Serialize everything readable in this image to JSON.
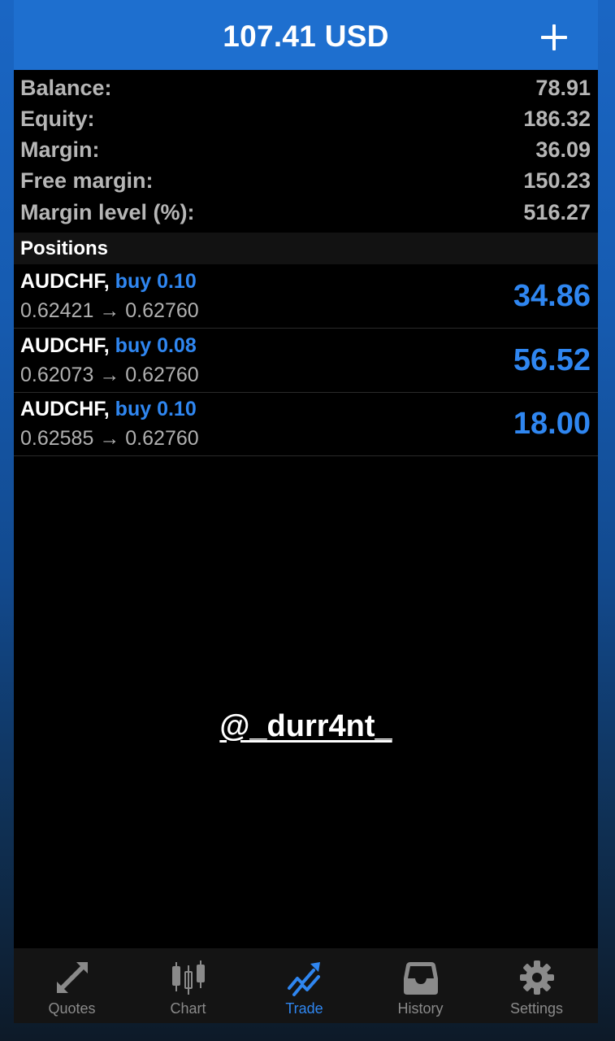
{
  "header": {
    "title": "107.41 USD",
    "add_icon": "plus-icon"
  },
  "summary": [
    {
      "label": "Balance:",
      "value": "78.91"
    },
    {
      "label": "Equity:",
      "value": "186.32"
    },
    {
      "label": "Margin:",
      "value": "36.09"
    },
    {
      "label": "Free margin:",
      "value": "150.23"
    },
    {
      "label": "Margin level (%):",
      "value": "516.27"
    }
  ],
  "positions": {
    "title": "Positions",
    "items": [
      {
        "symbol": "AUDCHF,",
        "direction": "buy 0.10",
        "open_price": "0.62421",
        "arrow": "→",
        "current_price": "0.62760",
        "profit": "34.86"
      },
      {
        "symbol": "AUDCHF,",
        "direction": "buy 0.08",
        "open_price": "0.62073",
        "arrow": "→",
        "current_price": "0.62760",
        "profit": "56.52"
      },
      {
        "symbol": "AUDCHF,",
        "direction": "buy 0.10",
        "open_price": "0.62585",
        "arrow": "→",
        "current_price": "0.62760",
        "profit": "18.00"
      }
    ]
  },
  "watermark": "@_durr4nt_",
  "tabbar": {
    "active": "Trade",
    "tabs": [
      {
        "label": "Quotes",
        "icon": "quotes-arrows-icon"
      },
      {
        "label": "Chart",
        "icon": "candlestick-chart-icon"
      },
      {
        "label": "Trade",
        "icon": "trade-trend-icon"
      },
      {
        "label": "History",
        "icon": "inbox-history-icon"
      },
      {
        "label": "Settings",
        "icon": "gear-icon"
      }
    ]
  },
  "colors": {
    "header_blue": "#1e6fcf",
    "accent_blue": "#2f86f0",
    "text_grey": "#b6b6b6",
    "tab_inactive": "#8a8a8a"
  }
}
